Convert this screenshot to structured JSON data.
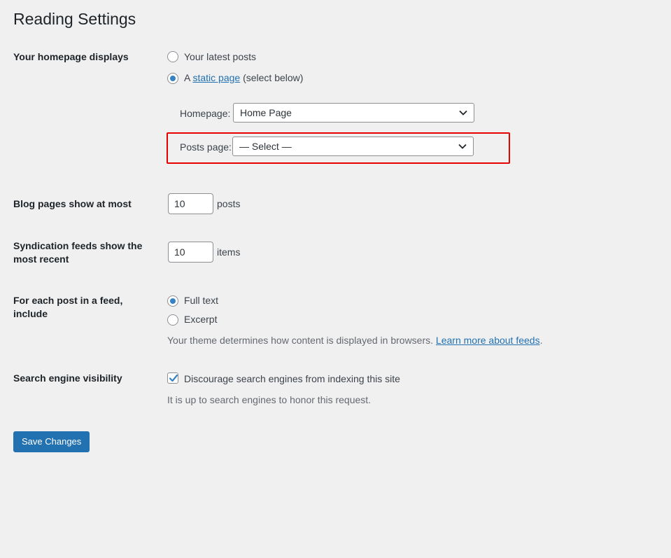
{
  "page": {
    "title": "Reading Settings"
  },
  "homepage_displays": {
    "label": "Your homepage displays",
    "option_latest": "Your latest posts",
    "option_static_prefix": "A",
    "option_static_link": "static page",
    "option_static_suffix": "(select below)",
    "selected": "static",
    "homepage_label": "Homepage:",
    "homepage_value": "Home Page",
    "posts_page_label": "Posts page:",
    "posts_page_value": "— Select —"
  },
  "blog_pages": {
    "label": "Blog pages show at most",
    "value": "10",
    "unit": "posts"
  },
  "syndication": {
    "label": "Syndication feeds show the most recent",
    "value": "10",
    "unit": "items"
  },
  "feed_include": {
    "label": "For each post in a feed, include",
    "option_full": "Full text",
    "option_excerpt": "Excerpt",
    "selected": "full",
    "description": "Your theme determines how content is displayed in browsers.",
    "link": "Learn more about feeds",
    "link_suffix": "."
  },
  "search_visibility": {
    "label": "Search engine visibility",
    "checkbox_label": "Discourage search engines from indexing this site",
    "checked": true,
    "description": "It is up to search engines to honor this request."
  },
  "actions": {
    "save_label": "Save Changes"
  },
  "colors": {
    "accent": "#2271b1",
    "highlight": "#e60000",
    "background": "#f0f0f1"
  }
}
